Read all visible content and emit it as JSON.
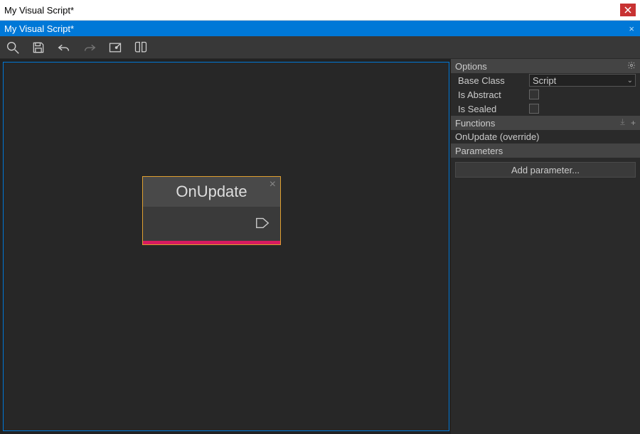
{
  "window": {
    "outer_title": "My Visual Script*",
    "inner_title": "My Visual Script*"
  },
  "node": {
    "title": "OnUpdate"
  },
  "sidebar": {
    "options_header": "Options",
    "base_class_label": "Base Class",
    "base_class_value": "Script",
    "is_abstract_label": "Is Abstract",
    "is_abstract_checked": false,
    "is_sealed_label": "Is Sealed",
    "is_sealed_checked": false,
    "functions_header": "Functions",
    "functions_items": [
      "OnUpdate (override)"
    ],
    "parameters_header": "Parameters",
    "add_parameter_label": "Add parameter..."
  }
}
